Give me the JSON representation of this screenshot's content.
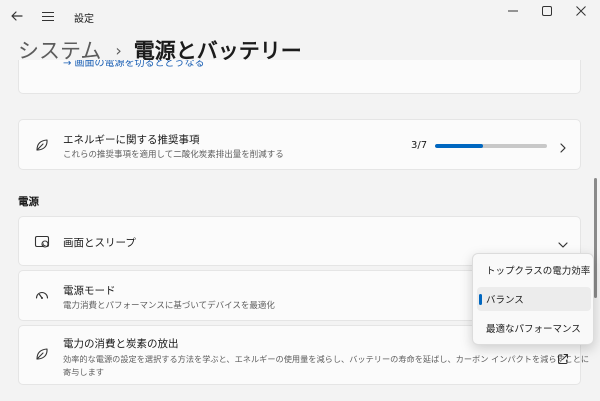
{
  "app": {
    "title": "設定"
  },
  "breadcrumb": {
    "root": "システム",
    "separator": "›",
    "current": "電源とバッテリー"
  },
  "cards": {
    "partial_link": "→ 画面の電源を切るとどうなる",
    "energy": {
      "title": "エネルギーに関する推奨事項",
      "subtitle": "これらの推奨事項を適用して二酸化炭素排出量を削減する",
      "progress_text": "3/7",
      "progress_fraction": 0.43
    },
    "power_section_heading": "電源",
    "screen_sleep": {
      "title": "画面とスリープ"
    },
    "power_mode": {
      "title": "電源モード",
      "subtitle": "電力消費とパフォーマンスに基づいてデバイスを最適化"
    },
    "emissions": {
      "title": "電力の消費と炭素の放出",
      "subtitle_line1": "効率的な電源の設定を選択する方法を学ぶと、エネルギーの使用量を減らし、バッテリーの寿命を延ばし、カーボン インパクトを減らすことに",
      "subtitle_line2": "寄与します"
    }
  },
  "power_mode_dropdown": {
    "options": [
      "トップクラスの電力効率",
      "バランス",
      "最適なパフォーマンス"
    ],
    "selected": "バランス"
  },
  "icons": {
    "back": "back-arrow-icon",
    "menu": "hamburger-menu-icon",
    "minimize": "minimize-icon",
    "maximize": "maximize-icon",
    "close": "close-icon",
    "leaf": "leaf-icon",
    "screen": "screen-sleep-icon",
    "gauge": "power-mode-gauge-icon",
    "external": "external-link-icon",
    "chevron_right": "chevron-right-icon",
    "chevron_down": "chevron-down-icon"
  },
  "colors": {
    "accent": "#0067c0",
    "background": "#f3f3f3",
    "card": "#fbfbfb"
  }
}
